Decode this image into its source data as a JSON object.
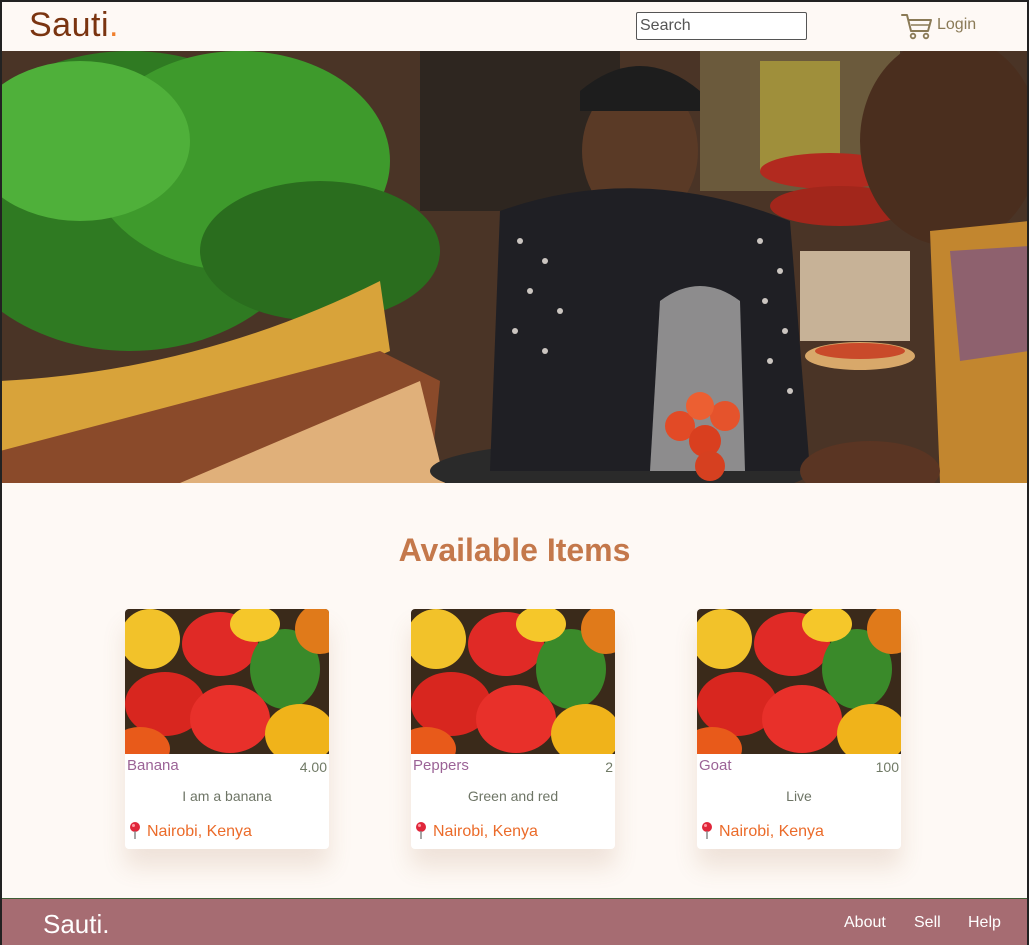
{
  "header": {
    "brand_name": "Sauti",
    "brand_dot": ".",
    "search_placeholder": "Search",
    "login_label": "Login"
  },
  "hero": {
    "image_subject": "market-vendor-photo"
  },
  "main": {
    "section_title": "Available Items",
    "items": [
      {
        "name": "Banana",
        "price": "4.00",
        "description": "I am a banana",
        "location": "Nairobi, Kenya",
        "image": "bell-peppers-photo"
      },
      {
        "name": "Peppers",
        "price": "2",
        "description": "Green and red",
        "location": "Nairobi, Kenya",
        "image": "bell-peppers-photo"
      },
      {
        "name": "Goat",
        "price": "100",
        "description": "Live",
        "location": "Nairobi, Kenya",
        "image": "bell-peppers-photo"
      }
    ]
  },
  "footer": {
    "brand": "Sauti.",
    "links": [
      "About",
      "Sell",
      "Help"
    ]
  },
  "colors": {
    "background": "#fef9f5",
    "brand": "#7a3410",
    "accent": "#f07f2c",
    "title": "#c4784b",
    "item_name": "#9b6396",
    "location": "#eb6b2a",
    "footer": "#a66c72"
  },
  "icons": {
    "cart": "shopping-cart-icon",
    "location": "map-pin-icon"
  }
}
